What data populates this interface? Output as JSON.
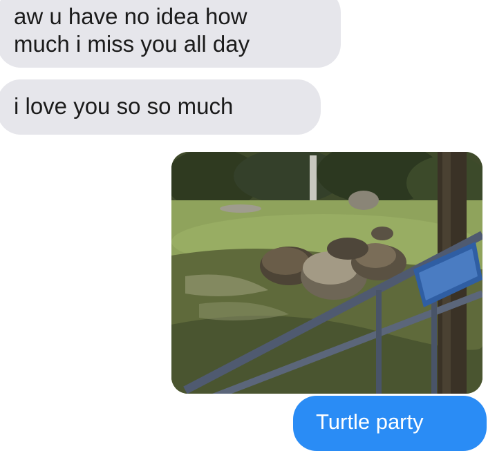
{
  "conversation": {
    "incoming": [
      {
        "lines": [
          "aw u have no idea how",
          "much i miss you all day"
        ]
      },
      {
        "lines": [
          "i love you so so much"
        ]
      }
    ],
    "outgoing_photo": {
      "subject": "tortoises-in-zoo-enclosure"
    },
    "outgoing": [
      {
        "text": "Turtle party"
      }
    ]
  },
  "colors": {
    "incoming_bubble": "#e6e6eb",
    "outgoing_bubble": "#2a8cf5",
    "incoming_text": "#1b1b1b",
    "outgoing_text": "#ffffff"
  }
}
